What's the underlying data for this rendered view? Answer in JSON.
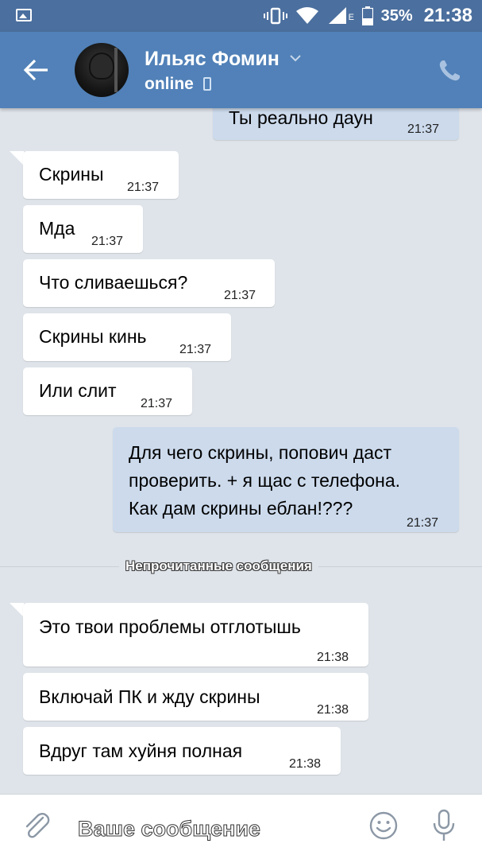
{
  "status_bar": {
    "battery": "35%",
    "time": "21:38",
    "network": "E"
  },
  "header": {
    "contact_name": "Ильяс Фомин",
    "status": "online"
  },
  "messages": [
    {
      "dir": "out",
      "text": "Ты реально даун",
      "time": "21:37"
    },
    {
      "dir": "in",
      "text": "Скрины",
      "time": "21:37"
    },
    {
      "dir": "in",
      "text": "Мда",
      "time": "21:37"
    },
    {
      "dir": "in",
      "text": "Что сливаешься?",
      "time": "21:37"
    },
    {
      "dir": "in",
      "text": "Скрины кинь",
      "time": "21:37"
    },
    {
      "dir": "in",
      "text": "Или слит",
      "time": "21:37"
    },
    {
      "dir": "out",
      "lines": [
        "Для чего скрины, попович даст",
        "проверить. + я щас с телефона.",
        "Как дам скрины еблан!???"
      ],
      "time": "21:37"
    },
    {
      "dir": "in",
      "text": "Это твои проблемы отглотышь",
      "time": "21:38"
    },
    {
      "dir": "in",
      "text": "Включай ПК и жду скрины",
      "time": "21:38"
    },
    {
      "dir": "in",
      "text": "Вдруг там хуйня полная",
      "time": "21:38"
    }
  ],
  "unread_divider": "Непрочитанные сообщения",
  "composer": {
    "placeholder": "Ваше сообщение"
  },
  "colors": {
    "toolbar": "#5181b8",
    "status_bar": "#4b6f9e",
    "chat_bg": "#dfe4ea",
    "outgoing_bubble": "#ccdaec",
    "incoming_bubble": "#ffffff"
  },
  "icons": [
    "gallery-icon",
    "vibrate-icon",
    "wifi-icon",
    "signal-icon",
    "battery-icon",
    "back-arrow-icon",
    "chevron-down-icon",
    "phone-icon",
    "mobile-online-icon",
    "paperclip-icon",
    "emoji-icon",
    "microphone-icon"
  ]
}
